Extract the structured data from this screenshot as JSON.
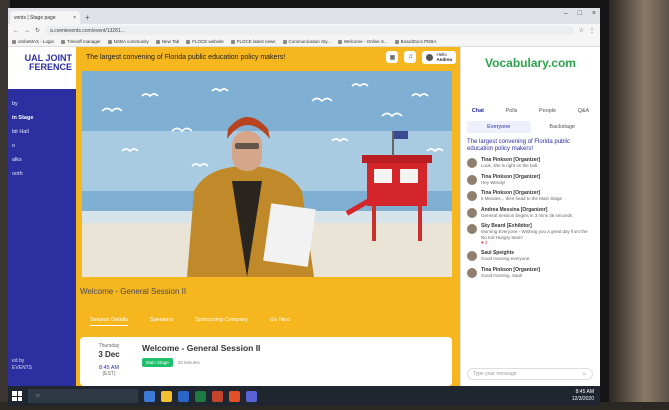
{
  "browser": {
    "tab_title": "vents | Stage page",
    "url": "a.cventevents.com/event/13281...",
    "bookmarks": [
      "ombeMAX - Login",
      "Timeoff manager",
      "NSBA community",
      "New Tab",
      "FLOCE website",
      "FLOCE latest news",
      "Communication Sty...",
      "Welcome - Online S...",
      "BoardDocs PDBA"
    ]
  },
  "sidebar": {
    "brand": "UAL JOINT FERENCE",
    "items": [
      {
        "label": "by"
      },
      {
        "label": "in Stage",
        "active": true
      },
      {
        "label": "bit Hall"
      },
      {
        "label": "o"
      },
      {
        "label": "alks"
      },
      {
        "label": "ooth"
      }
    ],
    "footer_line1": "ed by",
    "footer_line2": "EVENTS"
  },
  "header": {
    "tagline": "The largest convening of Florida public education policy makers!",
    "user_greeting": "Hello",
    "user_name": "Andrea"
  },
  "session": {
    "title": "Welcome - General Session II",
    "tabs": [
      "Session Details",
      "Speakers",
      "Sponsoring Company",
      "Go Next"
    ],
    "card": {
      "weekday": "Thursday",
      "date": "3 Dec",
      "time": "8:45 AM",
      "timezone": "(EST)",
      "title": "Welcome - General Session II",
      "badge": "Main Stage",
      "duration": "20 Minutes"
    }
  },
  "chat": {
    "logo": "Vocabulary.com",
    "tabs": [
      "Chat",
      "Polls",
      "People",
      "Q&A"
    ],
    "subtabs": [
      "Everyone",
      "Backstage"
    ],
    "pinned": "The largest convening of Florida public education policy makers!",
    "messages": [
      {
        "name": "Tina Pinkson [Organizer]",
        "text": "Look, she is right on the ball."
      },
      {
        "name": "Tina Pinkson [Organizer]",
        "text": "Hey Wendy!"
      },
      {
        "name": "Tina Pinkson [Organizer]",
        "text": "5 Minutes... then head to the Main Stage"
      },
      {
        "name": "Andrea Messina [Organizer]",
        "text": "General Session begins in 3 mins 36 seconds"
      },
      {
        "name": "Sky Beard [Exhibitor]",
        "text": "Morning Everyone - Wishing you a great day from the No Kid Hungry team!",
        "reaction": "♥ 2"
      },
      {
        "name": "Saul Speights",
        "text": "Good morning everyone."
      },
      {
        "name": "Tina Pinkson [Organizer]",
        "text": "Good morning, Saul!"
      }
    ],
    "input_placeholder": "Type your message"
  },
  "taskbar": {
    "search_label": "",
    "time": "8:45 AM",
    "date": "12/3/2020"
  },
  "colors": {
    "sidebar": "#2c2fa0",
    "main_bg": "#f5b61e",
    "badge": "#1fbf6b",
    "logo": "#2aa34a"
  }
}
